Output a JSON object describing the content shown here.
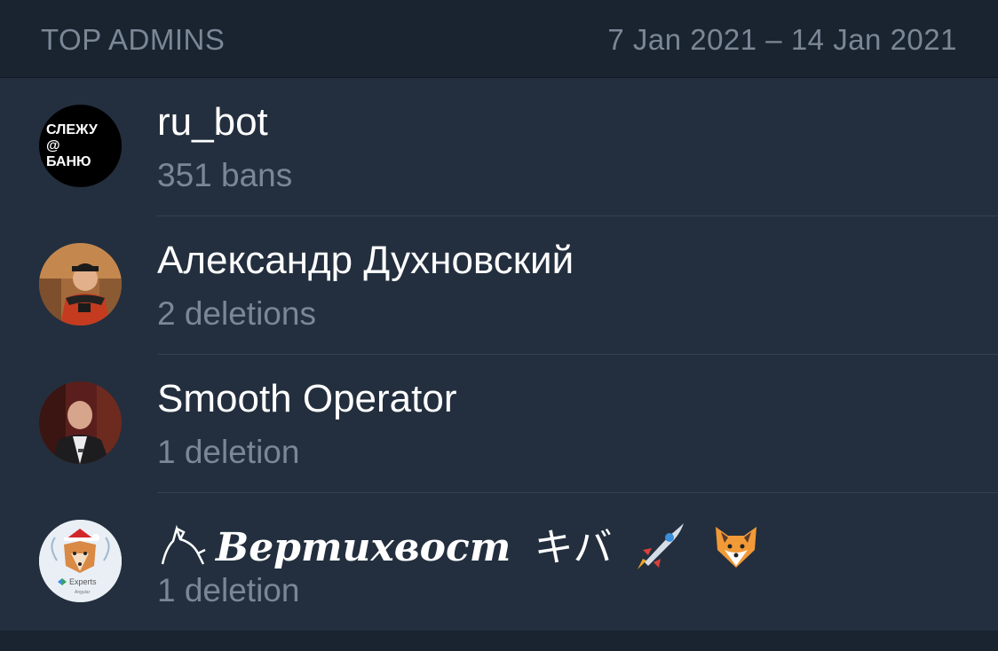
{
  "header": {
    "title": "TOP ADMINS",
    "date_range": "7 Jan 2021 – 14 Jan 2021"
  },
  "admins": [
    {
      "name": "ru_bot",
      "stat": "351 bans",
      "avatar_text": [
        "СЛЕЖУ",
        "@",
        "БАНЮ"
      ]
    },
    {
      "name": "Александр Духновский",
      "stat": "2 deletions"
    },
    {
      "name": "Smooth Operator",
      "stat": "1 deletion"
    },
    {
      "name_main": "Вертихвост",
      "name_kana": "キバ",
      "stat": "1 deletion",
      "avatar_text": "Experts",
      "avatar_subtext": "Angular"
    }
  ],
  "colors": {
    "header_bg": "#1a2431",
    "list_bg": "#232f3e",
    "primary_text": "#ffffff",
    "secondary_text": "#7b8796",
    "divider": "#344150"
  },
  "icons": {
    "name_prefix": "wolf-icon",
    "name_suffix": [
      "rocket-emoji-icon",
      "fox-emoji-icon"
    ]
  }
}
